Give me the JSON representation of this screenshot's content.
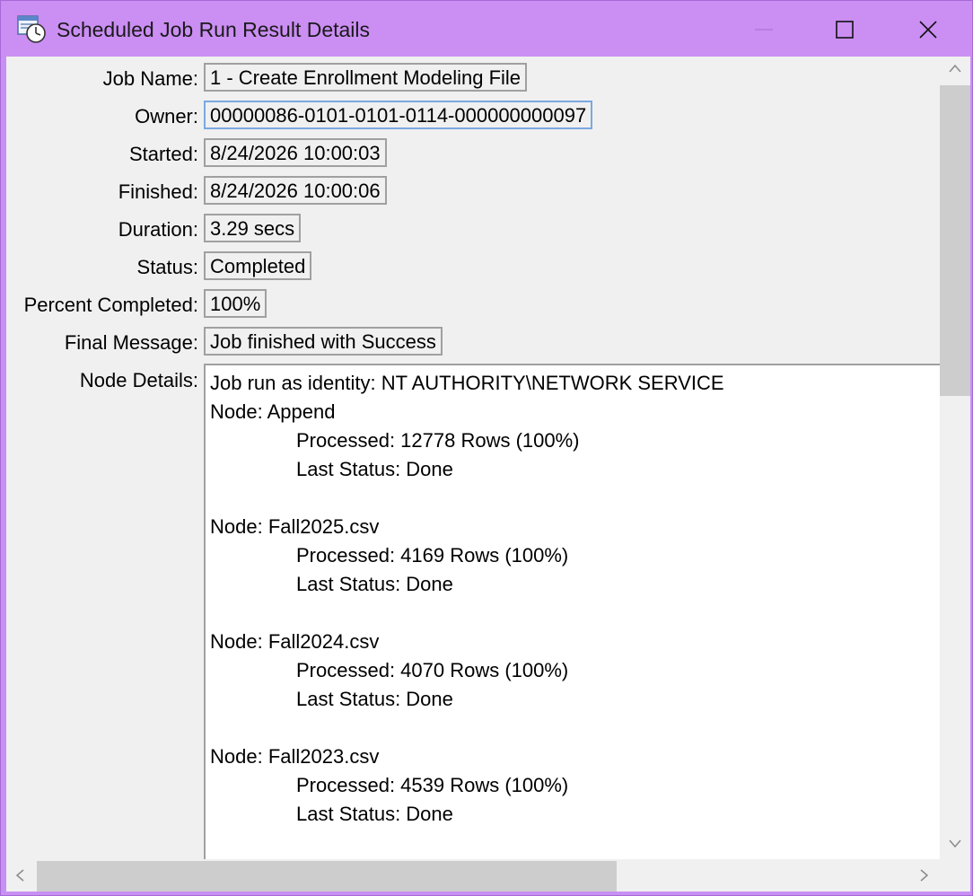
{
  "window": {
    "title": "Scheduled Job Run Result Details",
    "icon": "scheduled-job-icon"
  },
  "fields": {
    "job_name": {
      "label": "Job Name:",
      "value": "1 - Create Enrollment Modeling File"
    },
    "owner": {
      "label": "Owner:",
      "value": "00000086-0101-0101-0114-000000000097"
    },
    "started": {
      "label": "Started:",
      "value": "8/24/2026 10:00:03"
    },
    "finished": {
      "label": "Finished:",
      "value": "8/24/2026 10:00:06"
    },
    "duration": {
      "label": "Duration:",
      "value": "3.29 secs"
    },
    "status": {
      "label": "Status:",
      "value": "Completed"
    },
    "percent_completed": {
      "label": "Percent Completed:",
      "value": "100%"
    },
    "final_message": {
      "label": "Final Message:",
      "value": "Job finished with Success"
    },
    "node_details": {
      "label": "Node Details:"
    }
  },
  "node_details": {
    "identity_line": "Job run as identity: NT AUTHORITY\\NETWORK SERVICE",
    "nodes": [
      {
        "name": "Node: Append",
        "processed": "Processed: 12778 Rows (100%)",
        "status": "Last Status: Done"
      },
      {
        "name": "Node: Fall2025.csv",
        "processed": "Processed: 4169 Rows (100%)",
        "status": "Last Status: Done"
      },
      {
        "name": "Node: Fall2024.csv",
        "processed": "Processed: 4070 Rows (100%)",
        "status": "Last Status: Done"
      },
      {
        "name": "Node: Fall2023.csv",
        "processed": "Processed: 4539 Rows (100%)",
        "status": "Last Status: Done"
      }
    ]
  },
  "colors": {
    "titlebar": "#cb8ef3",
    "client": "#f0f0f0",
    "field_border": "#a0a0a0",
    "focus_border": "#7aa9e0"
  }
}
